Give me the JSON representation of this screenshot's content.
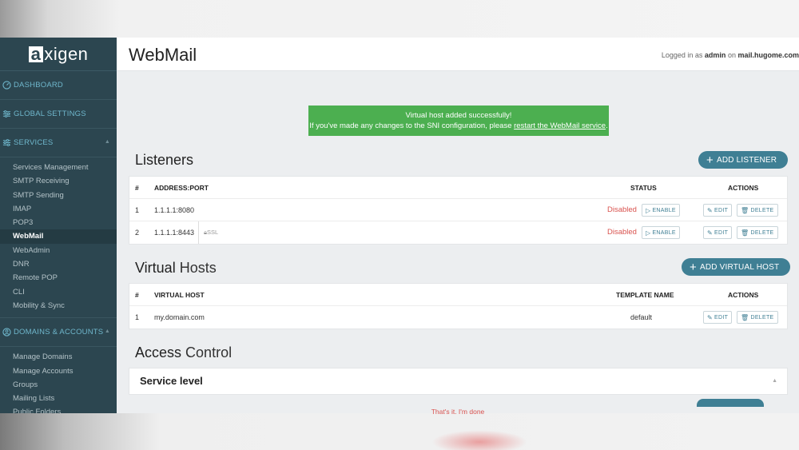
{
  "logo": {
    "a": "a",
    "rest": "xigen"
  },
  "header": {
    "title": "WebMail",
    "login_prefix": "Logged in as",
    "user": "admin",
    "on": "on",
    "host": "mail.hugome.com"
  },
  "sidebar": {
    "dashboard": "DASHBOARD",
    "global_settings": "GLOBAL SETTINGS",
    "services": "SERVICES",
    "service_items": [
      "Services Management",
      "SMTP Receiving",
      "SMTP Sending",
      "IMAP",
      "POP3",
      "WebMail",
      "WebAdmin",
      "DNR",
      "Remote POP",
      "CLI",
      "Mobility & Sync"
    ],
    "domains": "DOMAINS & ACCOUNTS",
    "domain_items": [
      "Manage Domains",
      "Manage Accounts",
      "Groups",
      "Mailing Lists",
      "Public Folders"
    ]
  },
  "toast": {
    "line1": "Virtual host added successfully!",
    "line2_prefix": "If you've made any changes to the SNI configuration, please",
    "line2_link": "restart the WebMail service",
    "line2_suffix": "."
  },
  "listeners": {
    "title": "Listeners",
    "add_button": "ADD LISTENER",
    "headers": {
      "num": "#",
      "address": "ADDRESS:PORT",
      "status": "STATUS",
      "actions": "ACTIONS"
    },
    "rows": [
      {
        "num": "1",
        "address": "1.1.1.1:8080",
        "ssl": "",
        "status": "Disabled"
      },
      {
        "num": "2",
        "address": "1.1.1.1:8443",
        "ssl": "SSL",
        "status": "Disabled"
      }
    ],
    "enable_label": "ENABLE",
    "edit_label": "EDIT",
    "delete_label": "DELETE"
  },
  "virtual_hosts": {
    "title_bold": "Virtual",
    "title_light": "Hosts",
    "add_button": "ADD VIRTUAL HOST",
    "headers": {
      "num": "#",
      "host": "VIRTUAL HOST",
      "template": "TEMPLATE NAME",
      "actions": "ACTIONS"
    },
    "rows": [
      {
        "num": "1",
        "host": "my.domain.com",
        "template": "default"
      }
    ],
    "edit_label": "EDIT",
    "delete_label": "DELETE"
  },
  "access_control": {
    "title_bold": "Access",
    "title_light": "Control",
    "service_level": "Service level"
  },
  "footer_text": "That's it. I'm done",
  "colors": {
    "sidebar": "#2c4650",
    "accent": "#3f7f94",
    "success": "#4caf50",
    "danger": "#d9534f"
  }
}
